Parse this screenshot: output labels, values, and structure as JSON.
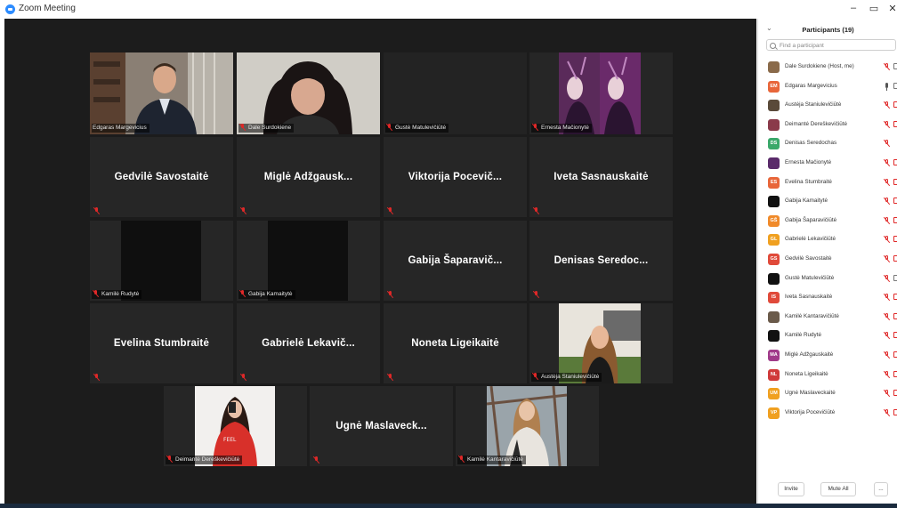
{
  "window": {
    "title": "Zoom Meeting",
    "minimize": "–",
    "restore": "▭",
    "close": "✕"
  },
  "tiles_row1": [
    {
      "name": "Edgaras Margevicius",
      "active": true
    },
    {
      "name": "Dale Surdokiene"
    },
    {
      "name": "Gustė Matulevičiūtė"
    },
    {
      "name": "Ernesta Mačionytė"
    }
  ],
  "tiles_row2": [
    {
      "display": "Gedvilė Savostaitė"
    },
    {
      "display": "Miglė Adžgausk..."
    },
    {
      "display": "Viktorija Pocevič..."
    },
    {
      "display": "Iveta Sasnauskaitė"
    }
  ],
  "tiles_row3": [
    {
      "name": "Kamilė Rudytė"
    },
    {
      "name": "Gabija Kamaitytė"
    },
    {
      "display": "Gabija Šaparavič..."
    },
    {
      "display": "Denisas Seredoc..."
    }
  ],
  "tiles_row4": [
    {
      "display": "Evelina Stumbraitė"
    },
    {
      "display": "Gabrielė Lekavič..."
    },
    {
      "display": "Noneta Ligeikaitė"
    },
    {
      "name": "Austėja Staniulevičiūtė"
    }
  ],
  "tiles_row5": [
    {
      "name": "Deimantė Dereškevičiūtė"
    },
    {
      "display": "Ugnė Maslaveck..."
    },
    {
      "name": "Kamilė Kantaravičiūtė"
    }
  ],
  "panel": {
    "title": "Participants (19)",
    "search_placeholder": "Find a participant",
    "participants": [
      {
        "name": "Dale Surdokiene (Host, me)",
        "initials": "",
        "color": "#8a6a4a",
        "mic": "off",
        "cam": "on"
      },
      {
        "name": "Edgaras Margevicius",
        "initials": "EM",
        "color": "#e8663a",
        "mic": "on",
        "cam": "on"
      },
      {
        "name": "Austėja Staniulevičiūtė",
        "initials": "",
        "color": "#5a4a3a",
        "mic": "off",
        "cam": "off"
      },
      {
        "name": "Deimantė Dereškevičiūtė",
        "initials": "",
        "color": "#8a3a4a",
        "mic": "off",
        "cam": "off"
      },
      {
        "name": "Denisas Seredochas",
        "initials": "DS",
        "color": "#3aa86a",
        "mic": "off",
        "cam": "none"
      },
      {
        "name": "Ernesta Mačionytė",
        "initials": "",
        "color": "#5a2a6a",
        "mic": "off",
        "cam": "off"
      },
      {
        "name": "Evelina Stumbraitė",
        "initials": "ES",
        "color": "#e8663a",
        "mic": "off",
        "cam": "off"
      },
      {
        "name": "Gabija Kamaitytė",
        "initials": "",
        "color": "#111111",
        "mic": "off",
        "cam": "off"
      },
      {
        "name": "Gabija Šaparavičiūtė",
        "initials": "GŠ",
        "color": "#f08a2a",
        "mic": "off",
        "cam": "off"
      },
      {
        "name": "Gabrielė Lekavičiūtė",
        "initials": "GL",
        "color": "#f0a020",
        "mic": "off",
        "cam": "off"
      },
      {
        "name": "Gedvilė Savostaitė",
        "initials": "GS",
        "color": "#e04a3a",
        "mic": "off",
        "cam": "off"
      },
      {
        "name": "Gustė Matulevičiūtė",
        "initials": "",
        "color": "#111111",
        "mic": "off",
        "cam": "on"
      },
      {
        "name": "Iveta Sasnauskaitė",
        "initials": "IS",
        "color": "#e04a3a",
        "mic": "off",
        "cam": "off"
      },
      {
        "name": "Kamilė Kantaravičiūtė",
        "initials": "",
        "color": "#6a5a4a",
        "mic": "off",
        "cam": "off"
      },
      {
        "name": "Kamilė Rudytė",
        "initials": "",
        "color": "#111111",
        "mic": "off",
        "cam": "off"
      },
      {
        "name": "Miglė Adžgauskaitė",
        "initials": "MA",
        "color": "#a03a8a",
        "mic": "off",
        "cam": "off"
      },
      {
        "name": "Noneta Ligeikaitė",
        "initials": "NL",
        "color": "#d03a3a",
        "mic": "off",
        "cam": "off"
      },
      {
        "name": "Ugnė Maslaveckaitė",
        "initials": "UM",
        "color": "#f0a020",
        "mic": "off",
        "cam": "off"
      },
      {
        "name": "Viktorija Pocevičiūtė",
        "initials": "VP",
        "color": "#f0a020",
        "mic": "off",
        "cam": "off"
      }
    ],
    "invite_label": "Invite",
    "mute_all_label": "Mute All",
    "more_label": "..."
  }
}
